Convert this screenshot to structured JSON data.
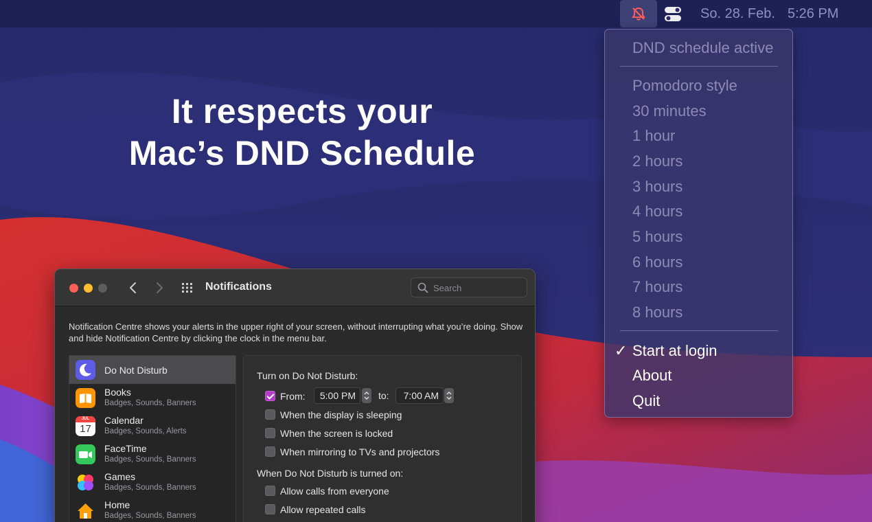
{
  "menubar": {
    "date": "So. 28. Feb.",
    "time": "5:26 PM",
    "dnd_icon": "bell-slash-icon",
    "toggle_icon": "switches-icon"
  },
  "headline": {
    "line1": "It respects your",
    "line2": "Mac’s DND Schedule"
  },
  "menu": {
    "status": "DND schedule active",
    "items": [
      "Pomodoro style",
      "30 minutes",
      "1 hour",
      "2 hours",
      "3 hours",
      "4 hours",
      "5 hours",
      "6 hours",
      "7 hours",
      "8 hours"
    ],
    "start_at_login": "Start at login",
    "start_at_login_checked": true,
    "about": "About",
    "quit": "Quit"
  },
  "prefs": {
    "title": "Notifications",
    "search_placeholder": "Search",
    "description": "Notification Centre shows your alerts in the upper right of your screen, without interrupting what you’re doing. Show and hide Notification Centre by clicking the clock in the menu bar.",
    "apps": [
      {
        "name": "Do Not Disturb",
        "sub": "",
        "icon": "moon-icon",
        "color": "#5e5ce6"
      },
      {
        "name": "Books",
        "sub": "Badges, Sounds, Banners",
        "icon": "books-icon",
        "color": "#ff9500"
      },
      {
        "name": "Calendar",
        "sub": "Badges, Sounds, Alerts",
        "icon": "calendar-icon",
        "color": "#ffffff"
      },
      {
        "name": "FaceTime",
        "sub": "Badges, Sounds, Banners",
        "icon": "facetime-icon",
        "color": "#34c759"
      },
      {
        "name": "Games",
        "sub": "Badges, Sounds, Banners",
        "icon": "games-icon",
        "color": "#ff6b8a"
      },
      {
        "name": "Home",
        "sub": "Badges, Sounds, Banners",
        "icon": "home-icon",
        "color": "#ff9f0a"
      }
    ],
    "calendar_month": "JUL",
    "calendar_day": "17",
    "dnd": {
      "turn_on_heading": "Turn on Do Not Disturb:",
      "from_label": "From:",
      "from_checked": true,
      "from_time": "5:00 PM",
      "to_label": "to:",
      "to_time": "7:00 AM",
      "options": [
        {
          "label": "When the display is sleeping",
          "checked": false
        },
        {
          "label": "When the screen is locked",
          "checked": false
        },
        {
          "label": "When mirroring to TVs and projectors",
          "checked": false
        }
      ],
      "when_on_heading": "When Do Not Disturb is turned on:",
      "call_options": [
        {
          "label": "Allow calls from everyone",
          "checked": false
        },
        {
          "label": "Allow repeated calls",
          "checked": false
        }
      ]
    }
  }
}
